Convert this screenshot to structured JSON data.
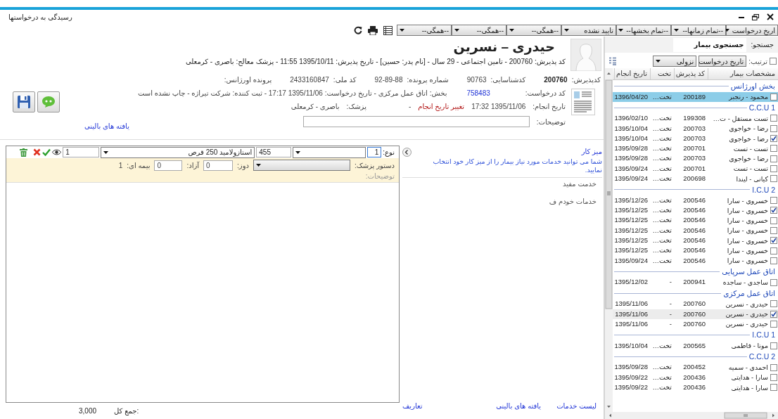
{
  "window": {
    "title": "رسیدگی به درخواستها"
  },
  "toolbar": {
    "filters": [
      "اریخ درخواست",
      "--تمام زمانها--",
      "--تمام بخشها--",
      "تایید نشده",
      "--همگی--",
      "--همگی--",
      "--همگی--"
    ]
  },
  "patient": {
    "name": "حیدری – نسرین",
    "summary": "کد پذیرش: 200760 - تامین اجتماعی - 29 سال - [نام پدر: حسین] - تاریخ پذیرش: 1395/10/11 11:55 - پزشک معالج: باصری - کرمعلی",
    "fields": [
      {
        "label": "کدپذیرش:",
        "value": "200760",
        "bold": true
      },
      {
        "label": "کدشناسایی:",
        "value": "90763",
        "bold": false
      },
      {
        "label": "شماره پرونده:",
        "value": "92-89-88",
        "bold": false
      },
      {
        "label": "کد ملی:",
        "value": "2433160847",
        "bold": false
      },
      {
        "label": "پرونده اورژانس:",
        "bold": false
      }
    ]
  },
  "request": {
    "code_label": "کد درخواست:",
    "code": "758483",
    "details": "بخش: اتاق عمل مرکزی - تاریخ درخواست: 1395/11/06 17:17 - ثبت کننده: شرکت تیراژه - چاپ نشده است",
    "done_label": "تاریخ انجام:",
    "done_date": "1395/11/06 17:32",
    "change_date_link": "تغییر تاریخ انجام",
    "dash": "-",
    "doctor_label": "پزشک:",
    "doctor": "باصری - کرمعلی",
    "notes_label": "توضیحات:"
  },
  "clinical_findings_link": "یافته های بالینی",
  "order_item": {
    "type_label": "نوع:",
    "type_value": "1",
    "code": "455",
    "drug": "استازولامید 250 قرص",
    "quantity": "1",
    "doctor_order_label": "دستور پزشک:",
    "dose_label": "دوز:",
    "dose": "0",
    "free_label": "آزاد:",
    "free": "0",
    "insured_label": "بیمه ای:",
    "insured": "1",
    "notes_label": "توضیحات:"
  },
  "workdesk": {
    "title": "میز کار",
    "hint": "شما می توانید خدمات مورد نیاز بیمار را از میز کار خود انتخاب نمایید.",
    "items": [
      "خدمت مفید",
      "خدمات خودم ف"
    ]
  },
  "bottom_links": [
    "لیست خدمات",
    "یافته های بالینی",
    "تعاریف"
  ],
  "total": {
    "label": "جمع کل:",
    "value": "3,000"
  },
  "patient_list": {
    "search_label": "جستجو:",
    "search_placeholder": "جستجوی بیمار",
    "sort_checked": false,
    "sort_label": "ترتیب:",
    "sort_by": "تاریخ درخواست",
    "sort_order": "نزولی",
    "columns": [
      "مشخصات بیمار",
      "کد پذیرش",
      "تخت",
      "تاریخ انجام"
    ],
    "groups": [
      {
        "name": "بخش اورژانس",
        "rows": [
          {
            "patient": "محمود - رنجبر",
            "code": "200189",
            "bed": "تخت…",
            "date": "1396/04/20",
            "checked": false,
            "selected": true,
            "hovered": false
          }
        ]
      },
      {
        "name": "C.C.U 1",
        "rows": [
          {
            "patient": "تست مستقل - ت…",
            "code": "199308",
            "bed": "تخت…",
            "date": "1396/02/10",
            "checked": false,
            "selected": false,
            "hovered": false
          },
          {
            "patient": "رضا - خواجوی",
            "code": "200703",
            "bed": "تخت…",
            "date": "1395/10/04",
            "checked": false,
            "selected": false,
            "hovered": false
          },
          {
            "patient": "رضا - خواجوی",
            "code": "200703",
            "bed": "تخت…",
            "date": "1395/10/04",
            "checked": true,
            "selected": false,
            "hovered": false
          },
          {
            "patient": "تست - تست",
            "code": "200701",
            "bed": "تخت…",
            "date": "1395/09/28",
            "checked": false,
            "selected": false,
            "hovered": false
          },
          {
            "patient": "رضا - خواجوی",
            "code": "200703",
            "bed": "تخت…",
            "date": "1395/09/28",
            "checked": false,
            "selected": false,
            "hovered": false
          },
          {
            "patient": "تست - تست",
            "code": "200701",
            "bed": "تخت…",
            "date": "1395/09/24",
            "checked": false,
            "selected": false,
            "hovered": false
          },
          {
            "patient": "کیانی - لیندا",
            "code": "200698",
            "bed": "تخت…",
            "date": "1395/09/24",
            "checked": false,
            "selected": false,
            "hovered": false
          }
        ]
      },
      {
        "name": "I.C.U 2",
        "rows": [
          {
            "patient": "خسروی - سارا",
            "code": "200546",
            "bed": "تخت…",
            "date": "1395/12/26",
            "checked": false,
            "selected": false,
            "hovered": false
          },
          {
            "patient": "خسروی - سارا",
            "code": "200546",
            "bed": "تخت…",
            "date": "1395/12/25",
            "checked": true,
            "selected": false,
            "hovered": false
          },
          {
            "patient": "خسروی - سارا",
            "code": "200546",
            "bed": "تخت…",
            "date": "1395/12/25",
            "checked": false,
            "selected": false,
            "hovered": false
          },
          {
            "patient": "خسروی - سارا",
            "code": "200546",
            "bed": "تخت…",
            "date": "1395/12/25",
            "checked": false,
            "selected": false,
            "hovered": false
          },
          {
            "patient": "خسروی - سارا",
            "code": "200546",
            "bed": "تخت…",
            "date": "1395/12/25",
            "checked": true,
            "selected": false,
            "hovered": false
          },
          {
            "patient": "خسروی - سارا",
            "code": "200546",
            "bed": "تخت…",
            "date": "1395/12/25",
            "checked": false,
            "selected": false,
            "hovered": false
          },
          {
            "patient": "خسروی - سارا",
            "code": "200546",
            "bed": "تخت…",
            "date": "1395/09/24",
            "checked": false,
            "selected": false,
            "hovered": false
          }
        ]
      },
      {
        "name": "اتاق عمل سرپایی",
        "rows": [
          {
            "patient": "ساجدی - ساجده",
            "code": "200941",
            "bed": "-",
            "date": "1395/12/02",
            "checked": false,
            "selected": false,
            "hovered": false
          }
        ]
      },
      {
        "name": "اتاق عمل مرکزی",
        "rows": [
          {
            "patient": "حیدری - نسرین",
            "code": "200760",
            "bed": "-",
            "date": "1395/11/06",
            "checked": false,
            "selected": false,
            "hovered": false
          },
          {
            "patient": "حیدری - نسرین",
            "code": "200760",
            "bed": "-",
            "date": "1395/11/06",
            "checked": true,
            "selected": false,
            "hovered": true
          },
          {
            "patient": "حیدری - نسرین",
            "code": "200760",
            "bed": "-",
            "date": "1395/11/06",
            "checked": false,
            "selected": false,
            "hovered": false
          }
        ]
      },
      {
        "name": "I.C.U 1",
        "rows": [
          {
            "patient": "مونا - فاطمی",
            "code": "200565",
            "bed": "تخت…",
            "date": "1395/10/04",
            "checked": false,
            "selected": false,
            "hovered": false
          }
        ]
      },
      {
        "name": "C.C.U 2",
        "rows": [
          {
            "patient": "احمدی - سمیه",
            "code": "200452",
            "bed": "تخت…",
            "date": "1395/09/28",
            "checked": false,
            "selected": false,
            "hovered": false
          },
          {
            "patient": "سارا - هدایتی",
            "code": "200436",
            "bed": "تخت…",
            "date": "1395/09/22",
            "checked": false,
            "selected": false,
            "hovered": false
          },
          {
            "patient": "سارا - هدایتی",
            "code": "200436",
            "bed": "تخت…",
            "date": "1395/09/22",
            "checked": false,
            "selected": false,
            "hovered": false
          }
        ]
      }
    ]
  }
}
